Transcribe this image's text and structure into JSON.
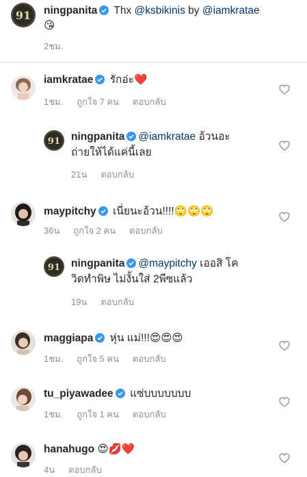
{
  "comments": [
    {
      "user": "ningpanita",
      "text_parts": [
        " Thx ",
        "@ksbikinis",
        " by ",
        "@iamkratae"
      ],
      "text_line2": "😘",
      "time": "2ชม."
    },
    {
      "user": "iamkratae",
      "text": " รักอ่ะ❤️",
      "time": "1ชม.",
      "likes": "ถูกใจ 7 คน",
      "reply": "ตอบกลับ"
    },
    {
      "user": "ningpanita",
      "mention": "@iamkratae",
      "text": " อ้วนอะ",
      "text_line2": "ถ่ายให้ได้แค่นี้เลย",
      "time": "21น",
      "reply": "ตอบกลับ"
    },
    {
      "user": "maypitchy",
      "text": " เนี่ยนะอ้วน!!!!",
      "emojis": "🙄🙄🙄",
      "time": "36น",
      "likes": "ถูกใจ 2 คน",
      "reply": "ตอบกลับ"
    },
    {
      "user": "ningpanita",
      "mention": "@maypitchy",
      "text": " เออสิ โค",
      "text_line2": "วิดทำพิษ ไม่งั้นใส่ 2พีซแล้ว",
      "time": "19น",
      "reply": "ตอบกลับ"
    },
    {
      "user": "maggiapa",
      "text": " หุ่น แม่!!!",
      "emojis": "😍😍😍",
      "time": "1ชม.",
      "likes": "ถูกใจ 5 คน",
      "reply": "ตอบกลับ"
    },
    {
      "user": "tu_piyawadee",
      "text": " แซ่บบบบบบบ",
      "time": "1ชม.",
      "likes": "ถูกใจ 1 คน",
      "reply": "ตอบกลับ"
    },
    {
      "user": "hanahugo",
      "emojis": "😍💋❤️",
      "time": "4น",
      "reply": "ตอบกลับ"
    }
  ],
  "icons": {
    "verified": "verified-badge-icon",
    "like": "heart-outline-icon"
  },
  "colors": {
    "verified": "#3897f0",
    "mention": "#003569",
    "meta": "#8e8e8e"
  }
}
